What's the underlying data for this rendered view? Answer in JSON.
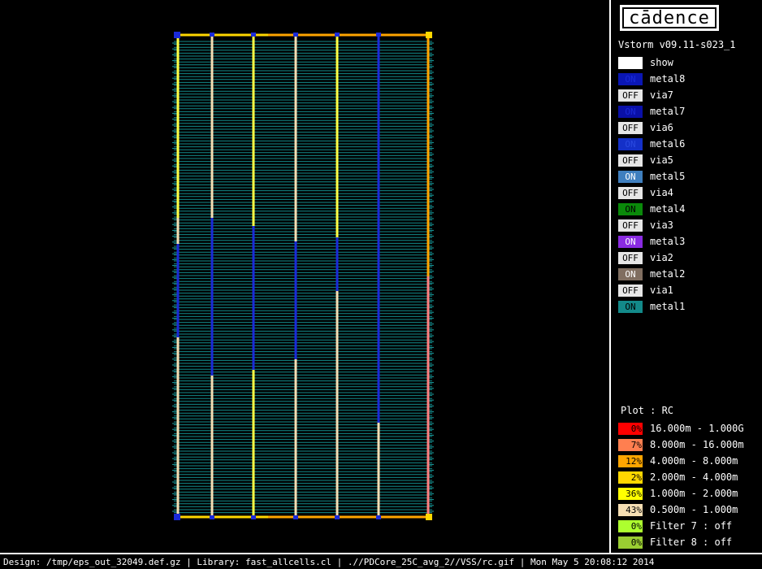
{
  "app": {
    "logo_text": "cādence",
    "version": "Vstorm v09.11-s023_1"
  },
  "layers": [
    {
      "state": "",
      "name": "show",
      "color": "#ffffff",
      "text_color": "#000000"
    },
    {
      "state": "ON",
      "name": "metal8",
      "color": "#0a16b4",
      "text_color": "#1a2ad8"
    },
    {
      "state": "OFF",
      "name": "via7",
      "color": "#e6e6e6",
      "text_color": "#000000"
    },
    {
      "state": "ON",
      "name": "metal7",
      "color": "#0a10a8",
      "text_color": "#1a2ad8"
    },
    {
      "state": "OFF",
      "name": "via6",
      "color": "#e6e6e6",
      "text_color": "#000000"
    },
    {
      "state": "ON",
      "name": "metal6",
      "color": "#1430c8",
      "text_color": "#2a4ae0"
    },
    {
      "state": "OFF",
      "name": "via5",
      "color": "#e6e6e6",
      "text_color": "#000000"
    },
    {
      "state": "ON",
      "name": "metal5",
      "color": "#3f7fbf",
      "text_color": "#ffffff"
    },
    {
      "state": "OFF",
      "name": "via4",
      "color": "#e6e6e6",
      "text_color": "#000000"
    },
    {
      "state": "ON",
      "name": "metal4",
      "color": "#0a8a0a",
      "text_color": "#000000"
    },
    {
      "state": "OFF",
      "name": "via3",
      "color": "#e6e6e6",
      "text_color": "#000000"
    },
    {
      "state": "ON",
      "name": "metal3",
      "color": "#8a2be2",
      "text_color": "#ffffff"
    },
    {
      "state": "OFF",
      "name": "via2",
      "color": "#e6e6e6",
      "text_color": "#000000"
    },
    {
      "state": "ON",
      "name": "metal2",
      "color": "#806e60",
      "text_color": "#ffffff"
    },
    {
      "state": "OFF",
      "name": "via1",
      "color": "#e6e6e6",
      "text_color": "#000000"
    },
    {
      "state": "ON",
      "name": "metal1",
      "color": "#138a8a",
      "text_color": "#000000"
    }
  ],
  "plot": {
    "title": "Plot : RC",
    "legend": [
      {
        "pct": "0%",
        "range": "16.000m - 1.000G",
        "color": "#ff0000"
      },
      {
        "pct": "7%",
        "range": "8.000m - 16.000m",
        "color": "#ff7f50"
      },
      {
        "pct": "12%",
        "range": "4.000m - 8.000m",
        "color": "#ffa500"
      },
      {
        "pct": "2%",
        "range": "2.000m - 4.000m",
        "color": "#ffd700"
      },
      {
        "pct": "36%",
        "range": "1.000m - 2.000m",
        "color": "#ffff00"
      },
      {
        "pct": "43%",
        "range": "0.500m - 1.000m",
        "color": "#f5deb3"
      },
      {
        "pct": "0%",
        "range": "Filter 7 : off",
        "color": "#adff2f"
      },
      {
        "pct": "0%",
        "range": "Filter 8 : off",
        "color": "#9acd32"
      }
    ]
  },
  "status": {
    "text": "Design: /tmp/eps_out_32049.def.gz | Library: fast_allcells.cl | .//PDCore_25C_avg_2//VSS/rc.gif | Mon May  5 20:08:12 2014"
  }
}
